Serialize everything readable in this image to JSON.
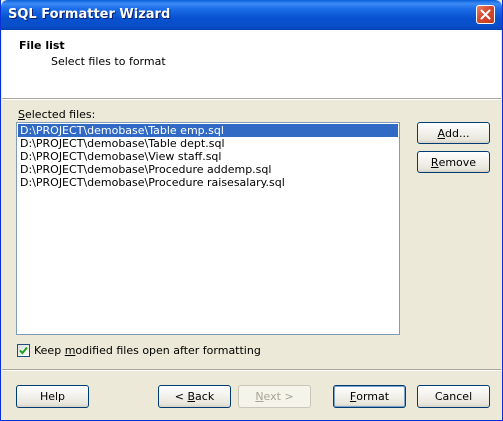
{
  "window": {
    "title": "SQL Formatter Wizard"
  },
  "header": {
    "title": "File list",
    "subtitle": "Select files to format"
  },
  "files": {
    "label_prefix": "",
    "label_hotkey": "S",
    "label_rest": "elected files:",
    "items": [
      "D:\\PROJECT\\demobase\\Table emp.sql",
      "D:\\PROJECT\\demobase\\Table dept.sql",
      "D:\\PROJECT\\demobase\\View staff.sql",
      "D:\\PROJECT\\demobase\\Procedure addemp.sql",
      "D:\\PROJECT\\demobase\\Procedure raisesalary.sql"
    ],
    "selected_index": 0
  },
  "buttons": {
    "add": {
      "hotkey": "A",
      "rest": "dd..."
    },
    "remove": {
      "hotkey": "R",
      "rest": "emove"
    },
    "help": "Help",
    "back": {
      "pre": "< ",
      "hotkey": "B",
      "rest": "ack"
    },
    "next": {
      "hotkey": "N",
      "rest": "ext >"
    },
    "format": {
      "hotkey": "F",
      "rest": "ormat"
    },
    "cancel": "Cancel"
  },
  "option": {
    "checked": true,
    "pre": "Keep ",
    "hotkey": "m",
    "rest": "odified files open after formatting"
  },
  "colors": {
    "title_bar": "#0a55d6",
    "selection": "#316ac5",
    "dialog_bg": "#ece9d8"
  },
  "icons": {
    "close": "close-icon",
    "check": "checkmark-icon"
  }
}
